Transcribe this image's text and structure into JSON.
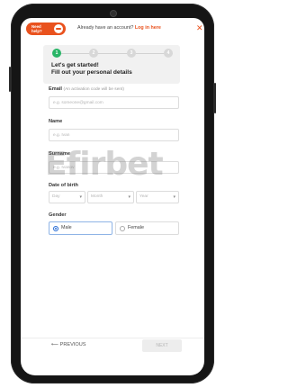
{
  "header": {
    "help_label": "Need help?",
    "account_question": "Already have an account?",
    "login_link": "Log in here",
    "close_icon": "close-icon"
  },
  "stepper": {
    "steps": [
      "1",
      "2",
      "3",
      "4"
    ],
    "active_step": 1,
    "title_line1": "Let's get started!",
    "title_line2": "Fill out your personal details"
  },
  "form": {
    "email": {
      "label": "Email",
      "hint": "(An activation code will be sent)",
      "placeholder": "e.g. someone@gmail.com"
    },
    "name": {
      "label": "Name",
      "placeholder": "e.g. Ivan"
    },
    "surname": {
      "label": "Surname",
      "placeholder": "e.g. Ivanov"
    },
    "dob": {
      "label": "Date of birth",
      "day": "Day",
      "month": "Month",
      "year": "Year"
    },
    "gender": {
      "label": "Gender",
      "options": [
        "Male",
        "Female"
      ],
      "selected": "Male"
    }
  },
  "footer": {
    "previous_label": "PREVIOUS",
    "next_label": "NEXT"
  },
  "watermark": "Efirbet",
  "colors": {
    "accent": "#e9521e",
    "step_active": "#29b567",
    "radio_selected": "#2c6fd6"
  }
}
